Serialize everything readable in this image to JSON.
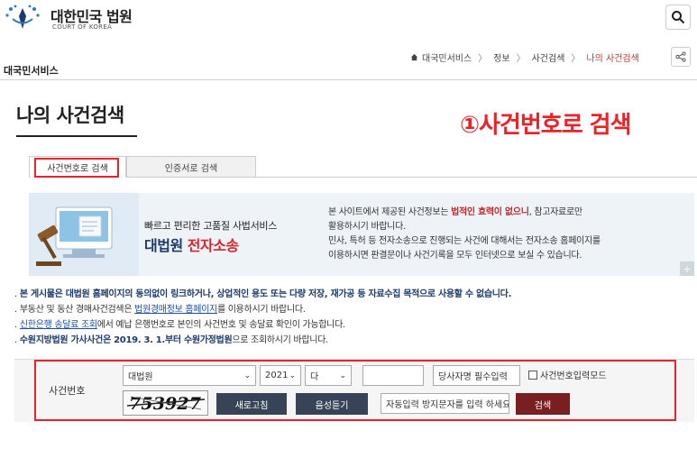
{
  "header": {
    "logo_ko": "대한민국 법원",
    "logo_en": "COURT OF KOREA",
    "search_icon": "search-icon"
  },
  "breadcrumb": {
    "section": "대국민서비스",
    "items": [
      "대국민서비스",
      "정보",
      "사건검색",
      "나의 사건검색"
    ],
    "home_icon": "home-icon",
    "share_icon": "share-icon"
  },
  "page_title": "나의 사건검색",
  "annotation": "①사건번호로 검색",
  "tabs": [
    {
      "label": "사건번호로 검색",
      "active": true
    },
    {
      "label": "인증서로 검색",
      "active": false
    }
  ],
  "banner": {
    "slogan": "빠르고 편리한 고품질 사법서비스",
    "brand_navy": "대법원",
    "brand_red": "전자소송",
    "notice_part1": "본 사이트에서 제공된 사건정보는 ",
    "notice_bold": "법적인 효력이 없으니",
    "notice_part2": ", 참고자료로만",
    "notice_line2": "활용하시기 바랍니다.",
    "notice_line3": "민사, 특허 등 전자소송으로 진행되는 사건에 대해서는 전자소송 홈페이지를",
    "notice_line4": "이용하시면 판결문이나 사건기록을 모두 인터넷으로 보실 수 있습니다.",
    "corner": "+"
  },
  "notices": {
    "line1": "본 게시물은 대법원 홈페이지의 동의없이 링크하거나, 상업적인 용도 또는 다량 저장, 재가공 등 자료수집 목적으로 사용할 수 없습니다.",
    "line2_pre": "부동산 및 동산 경매사건검색은 ",
    "line2_link": "법원경매정보 홈페이지",
    "line2_post": "를 이용하시기 바랍니다.",
    "line3_link": "신한은행 송달료 조회",
    "line3_post": "에서 예납 은행번호로 본인의 사건번호 및 송달료 확인이 가능합니다.",
    "line4_bold1": "수원지방법원 가사사건은 2019. 3. 1.",
    "line4_bold2": "부터 수원가정법원",
    "line4_post": "으로 조회하시기 바랍니다."
  },
  "form": {
    "label": "사건번호",
    "court_value": "대법원",
    "year_value": "2021",
    "type_value": "다",
    "number_value": "",
    "party_value": "당사자명 필수입력",
    "checkbox_label": "사건번호입력모드",
    "captcha_text": "753927",
    "refresh_label": "새로고침",
    "listen_label": "음성듣기",
    "captcha_input_value": "자동입력 방지문자를 입력 하세요",
    "search_label": "검색"
  }
}
